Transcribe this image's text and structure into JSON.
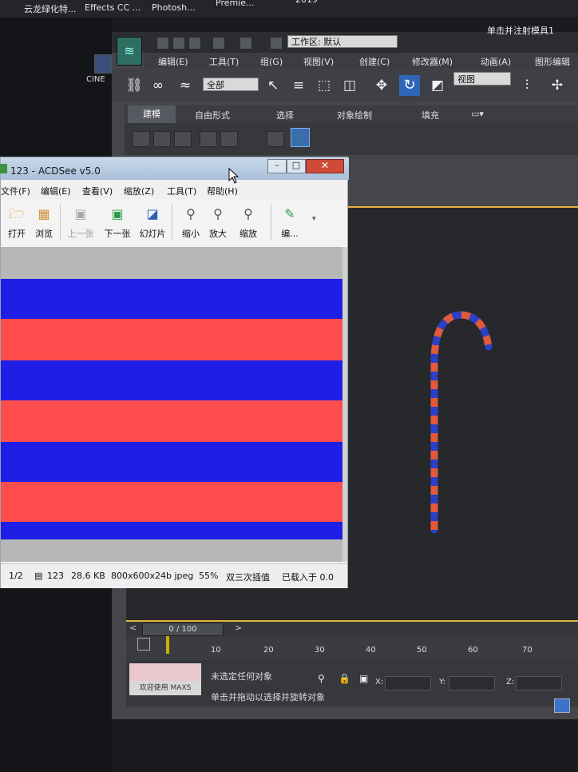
{
  "desktop": {
    "taskbar_items": [
      "云龙绿化特...",
      "Effects CC ...",
      "Photosh...",
      "Premie...",
      "2019"
    ],
    "shortcut_label": "CINE"
  },
  "max": {
    "workspace_label": "工作区: 默认",
    "title_right": "单击并注射模具1",
    "menu": [
      "编辑(E)",
      "工具(T)",
      "组(G)",
      "视图(V)",
      "创建(C)",
      "修改器(M)",
      "动画(A)",
      "图形编辑"
    ],
    "selection_filter": "全部",
    "view_select": "视图",
    "ribbon_tabs": [
      "建模",
      "自由形式",
      "选择",
      "对象绘制",
      "填充"
    ],
    "timeline": {
      "slider": "0 / 100",
      "ticks": [
        "10",
        "20",
        "30",
        "40",
        "50",
        "60",
        "70"
      ]
    },
    "status": {
      "welcome": "欢迎使用 MAXS",
      "selection": "未选定任何对象",
      "hint": "单击并拖动以选择并旋转对象",
      "x_label": "X:",
      "y_label": "Y:",
      "z_label": "Z:"
    },
    "colors": {
      "accent": "#e5b33a",
      "cane_red": "#e05a3a",
      "cane_blue": "#2b3fc7"
    }
  },
  "acdsee": {
    "title": "123 - ACDSee v5.0",
    "menu": [
      "文件(F)",
      "编辑(E)",
      "查看(V)",
      "缩放(Z)",
      "工具(T)",
      "帮助(H)"
    ],
    "toolbar": [
      {
        "label": "打开",
        "icon": "folder-open-icon",
        "enabled": true
      },
      {
        "label": "浏览",
        "icon": "browse-icon",
        "enabled": true
      },
      {
        "label": "上一张",
        "icon": "previous-image-icon",
        "enabled": false
      },
      {
        "label": "下一张",
        "icon": "next-image-icon",
        "enabled": true
      },
      {
        "label": "幻灯片",
        "icon": "slideshow-icon",
        "enabled": true
      },
      {
        "label": "缩小",
        "icon": "zoom-out-icon",
        "enabled": true
      },
      {
        "label": "放大",
        "icon": "zoom-in-icon",
        "enabled": true
      },
      {
        "label": "缩放",
        "icon": "zoom-icon",
        "enabled": true
      },
      {
        "label": "编...",
        "icon": "edit-icon",
        "enabled": true
      }
    ],
    "status": [
      "1/2",
      "123",
      "28.6 KB",
      "800x600x24b jpeg",
      "55%",
      "双三次插值",
      "已载入于 0.0"
    ],
    "image_colors": {
      "blue": "#1e1ee6",
      "red": "#ff4d4d",
      "grey": "#b7b7b7"
    }
  }
}
